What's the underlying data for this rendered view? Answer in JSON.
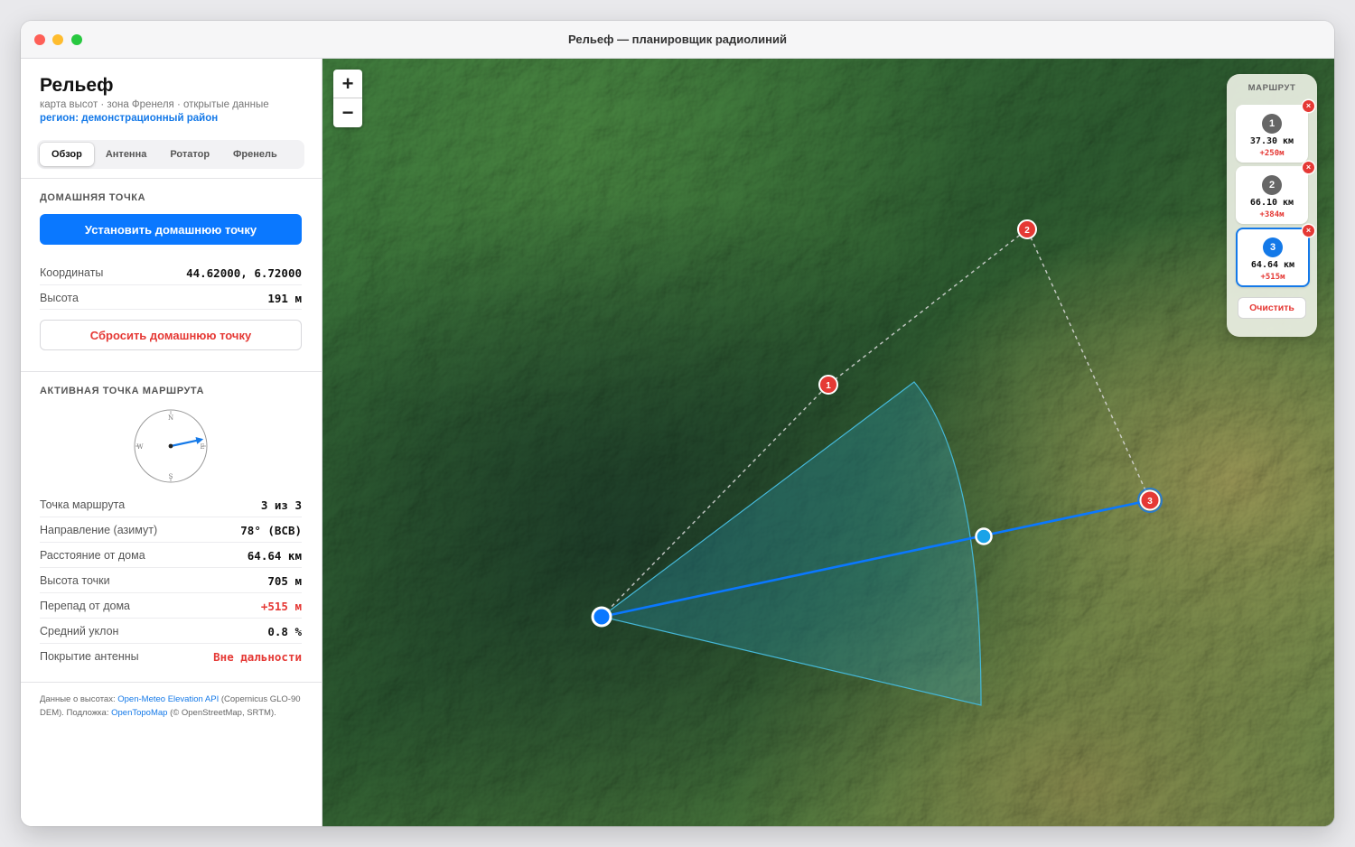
{
  "window": {
    "title": "Рельеф — планировщик радиолиний"
  },
  "sidebar": {
    "brand": "Рельеф",
    "subtitle": "карта высот · зона Френеля · открытые данные",
    "region": "регион: демонстрационный район",
    "tabs": [
      {
        "label": "Обзор",
        "active": true
      },
      {
        "label": "Антенна",
        "active": false
      },
      {
        "label": "Ротатор",
        "active": false
      },
      {
        "label": "Френель",
        "active": false
      }
    ],
    "home": {
      "section_title": "ДОМАШНЯЯ ТОЧКА",
      "set_button": "Установить домашнюю точку",
      "rows": [
        {
          "label": "Координаты",
          "value": "44.62000, 6.72000"
        },
        {
          "label": "Высота",
          "value": "191 м"
        }
      ],
      "reset_button": "Сбросить домашнюю точку"
    },
    "active": {
      "section_title": "АКТИВНАЯ ТОЧКА МАРШРУТА",
      "compass": {
        "n": "N",
        "e": "E",
        "s": "S",
        "w": "W",
        "azimuth_deg": 78
      },
      "rows": [
        {
          "label": "Точка маршрута",
          "value": "3 из 3"
        },
        {
          "label": "Направление (азимут)",
          "value": "78° (ВСВ)"
        },
        {
          "label": "Расстояние от дома",
          "value": "64.64 км"
        },
        {
          "label": "Высота точки",
          "value": "705 м"
        },
        {
          "label": "Перепад от дома",
          "value": "+515 м"
        },
        {
          "label": "Средний уклон",
          "value": "0.8 %"
        },
        {
          "label": "Покрытие антенны",
          "value": "Вне дальности"
        }
      ]
    },
    "footer": {
      "prefix": "Данные о высотах: ",
      "link1": "Open-Meteo Elevation API",
      "middle": " (Copernicus GLO-90 DEM). Подложка: ",
      "link2": "OpenTopoMap",
      "suffix": " (© OpenStreetMap, SRTM)."
    }
  },
  "map": {
    "zoom_in": "+",
    "zoom_out": "−",
    "waypoint_labels": [
      "1",
      "2",
      "3"
    ],
    "colors": {
      "route": "#0a78ff",
      "waypoint": "#e53935",
      "sector": "#2aa6c9"
    }
  },
  "route_panel": {
    "title": "МАРШРУТ",
    "items": [
      {
        "num": "1",
        "dist": "37.30 км",
        "diff": "+250м",
        "active": false
      },
      {
        "num": "2",
        "dist": "66.10 км",
        "diff": "+384м",
        "active": false
      },
      {
        "num": "3",
        "dist": "64.64 км",
        "diff": "+515м",
        "active": true
      }
    ],
    "delete_glyph": "×",
    "clear_button": "Очистить"
  }
}
